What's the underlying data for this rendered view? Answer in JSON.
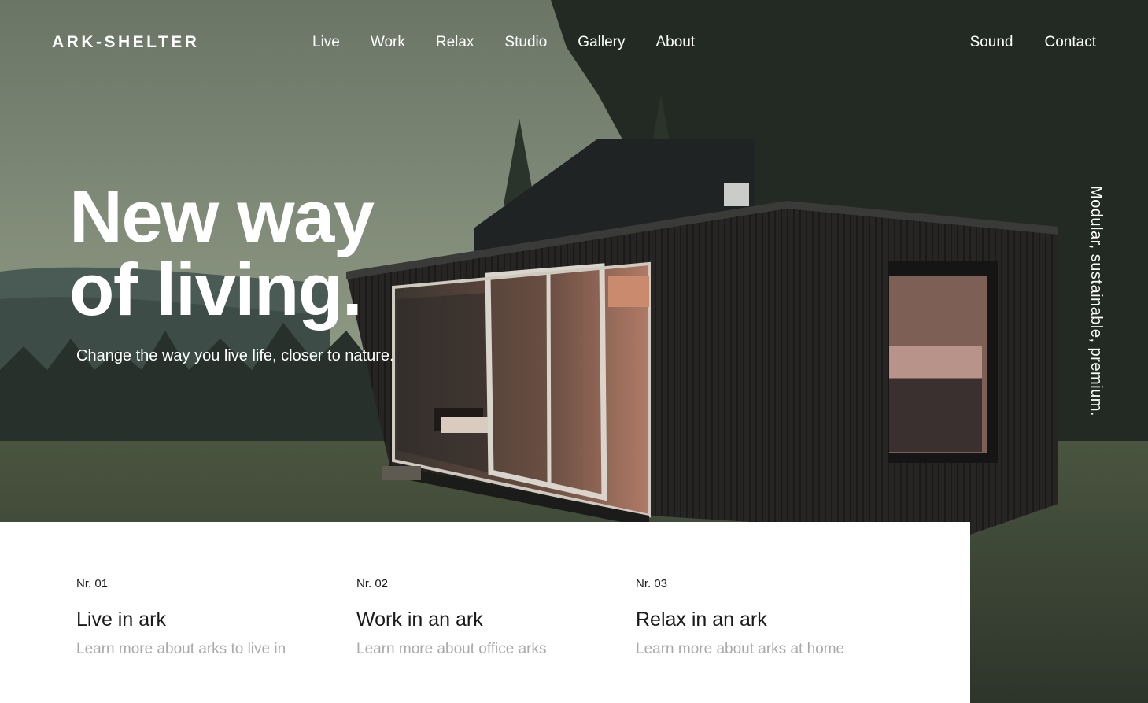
{
  "header": {
    "logo": "ARK-SHELTER",
    "nav": [
      "Live",
      "Work",
      "Relax",
      "Studio",
      "Gallery",
      "About"
    ],
    "secondary_nav": [
      "Sound",
      "Contact"
    ]
  },
  "hero": {
    "title_line1": "New way",
    "title_line2": "of living.",
    "subtitle": "Change the way you live life, closer to nature.",
    "tagline": "Modular, sustainable, premium."
  },
  "cards": [
    {
      "number": "Nr. 01",
      "title": "Live in ark",
      "description": "Learn more about arks to live in"
    },
    {
      "number": "Nr. 02",
      "title": "Work in an ark",
      "description": "Learn more about office arks"
    },
    {
      "number": "Nr. 03",
      "title": "Relax in an ark",
      "description": "Learn more about arks at home"
    }
  ],
  "colors": {
    "text_light": "#ffffff",
    "text_dark": "#1b1b1b",
    "text_muted": "#a9a9a9",
    "panel_bg": "#ffffff"
  }
}
